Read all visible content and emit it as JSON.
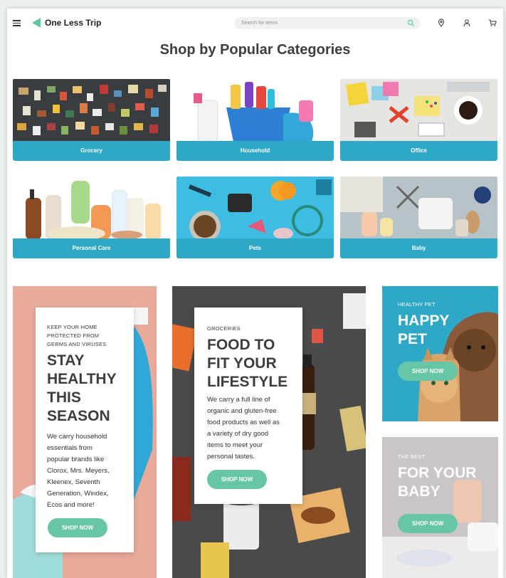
{
  "header": {
    "brand": "One Less Trip",
    "search_placeholder": "Search for items",
    "icons": [
      "menu-icon",
      "search-icon",
      "location-pin-icon",
      "user-icon",
      "cart-icon"
    ]
  },
  "page_title": "Shop by Popular Categories",
  "categories": [
    {
      "label": "Grocery"
    },
    {
      "label": "Household"
    },
    {
      "label": "Office"
    },
    {
      "label": "Personal Care"
    },
    {
      "label": "Pets"
    },
    {
      "label": "Baby"
    }
  ],
  "promos": {
    "household": {
      "kicker_line1": "KEEP YOUR HOME",
      "kicker_line2": "PROTECTED FROM",
      "kicker_line3": "GERMS AND VIRUSES",
      "title_line1": "STAY",
      "title_line2": "HEALTHY",
      "title_line3": "THIS",
      "title_line4": "SEASON",
      "body_line1": "We carry household",
      "body_line2": "essentials from",
      "body_line3": "popular brands like",
      "body_line4": "Clorox, Mrs. Meyers,",
      "body_line5": "Kleenex, Seventh",
      "body_line6": "Generation, Windex,",
      "body_line7": "Ecos and more!",
      "button": "SHOP NOW"
    },
    "groceries": {
      "kicker": "GROCERIES",
      "title_line1": "FOOD TO",
      "title_line2": "FIT YOUR",
      "title_line3": "LIFESTYLE",
      "body_line1": "We carry a full line of",
      "body_line2": "organic and gluten-free",
      "body_line3": "food products as well as",
      "body_line4": "a variety of dry good",
      "body_line5": "items to meet your",
      "body_line6": "personal tastes.",
      "button": "SHOP NOW"
    },
    "pet": {
      "kicker": "HEALTHY PET",
      "title_line1": "HAPPY",
      "title_line2": "PET",
      "button": "SHOP NOW"
    },
    "baby": {
      "kicker": "THE BEST",
      "title_line1": "FOR YOUR",
      "title_line2": "BABY",
      "button": "SHOP NOW"
    }
  },
  "colors": {
    "accent_blue": "#2fa8c8",
    "button_green": "#67c6a7",
    "brand_green": "#5cc8a0",
    "promo_pink": "#e8aa9b",
    "promo_dark": "#4a4a4a"
  }
}
